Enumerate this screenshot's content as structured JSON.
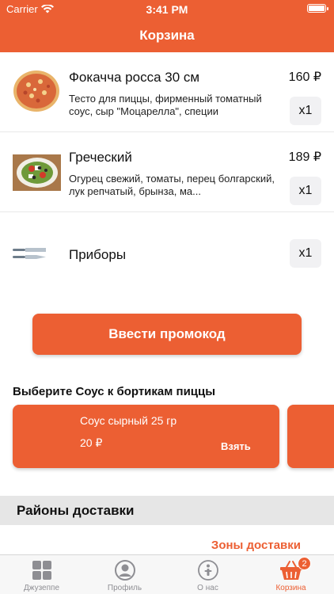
{
  "status_bar": {
    "carrier": "Carrier",
    "time": "3:41 PM"
  },
  "header": {
    "title": "Корзина"
  },
  "cart": {
    "items": [
      {
        "name": "Фокачча росса 30 см",
        "description": "Тесто для пиццы, фирменный томатный соус, сыр \"Моцарелла\", специи",
        "price": "160 ₽",
        "qty": "x1",
        "image": "pizza-image"
      },
      {
        "name": "Греческий",
        "description": "Огурец свежий, томаты, перец болгарский, лук репчатый, брынза, ма...",
        "price": "189 ₽",
        "qty": "x1",
        "image": "salad-image"
      },
      {
        "name": "Приборы",
        "qty": "x1",
        "image": "cutlery-icon"
      }
    ]
  },
  "promo": {
    "button_label": "Ввести промокод"
  },
  "sauces": {
    "heading": "Выберите Соус к бортикам пиццы",
    "cards": [
      {
        "name": "Соус сырный 25 гр",
        "price": "20 ₽",
        "action": "Взять"
      }
    ]
  },
  "districts": {
    "title": "Районы доставки",
    "zones_link": "Зоны доставки"
  },
  "tabbar": {
    "tabs": [
      {
        "label": "Джузеппе",
        "icon": "grid-icon",
        "active": false
      },
      {
        "label": "Профиль",
        "icon": "profile-icon",
        "active": false
      },
      {
        "label": "О нас",
        "icon": "info-icon",
        "active": false
      },
      {
        "label": "Корзина",
        "icon": "basket-icon",
        "active": true,
        "badge": "2"
      }
    ]
  },
  "colors": {
    "accent": "#ec5f33",
    "tab_inactive": "#8e8e93",
    "section_bg": "#e6e6e6"
  }
}
